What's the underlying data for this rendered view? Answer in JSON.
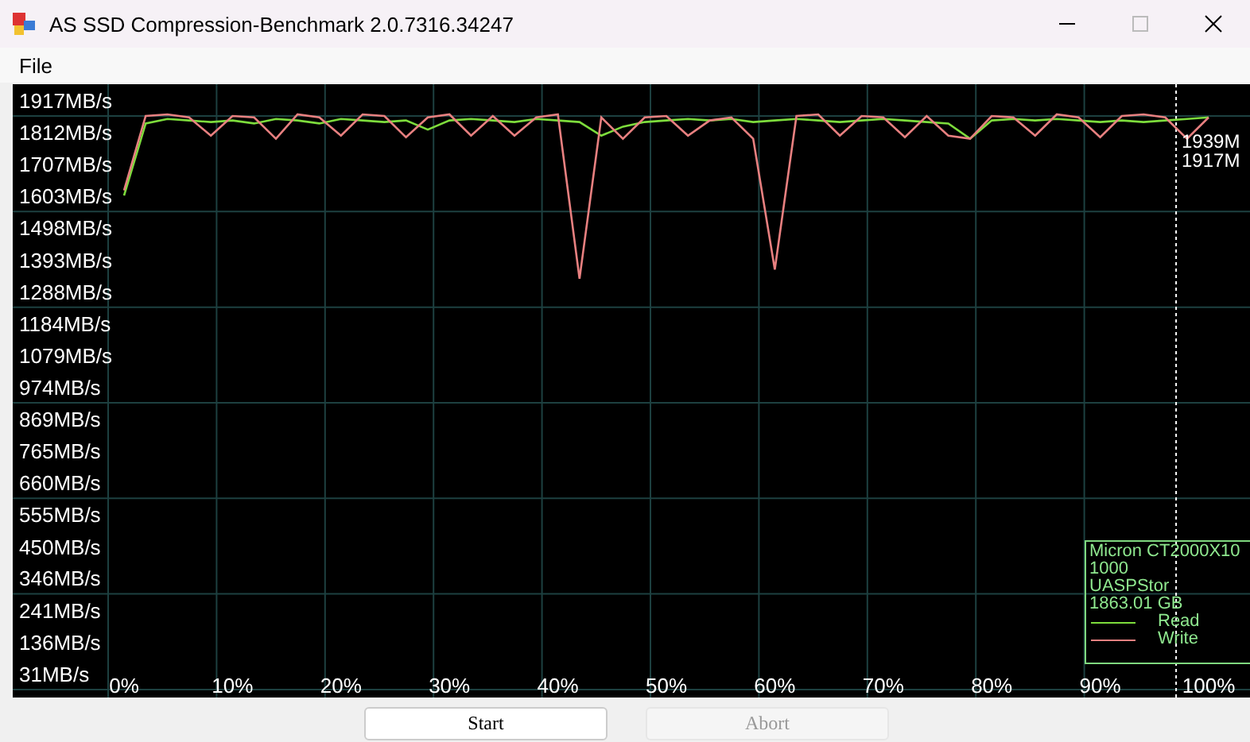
{
  "window": {
    "title": "AS SSD Compression-Benchmark 2.0.7316.34247"
  },
  "menu": [
    {
      "label": "File"
    }
  ],
  "chart": {
    "chart_data": {
      "type": "line",
      "xlim": [
        0,
        100
      ],
      "ylim": [
        31,
        1917
      ],
      "x": [
        0,
        2,
        4,
        6,
        8,
        10,
        12,
        14,
        16,
        18,
        20,
        22,
        24,
        26,
        28,
        30,
        32,
        34,
        36,
        38,
        40,
        42,
        44,
        46,
        48,
        50,
        52,
        54,
        56,
        58,
        60,
        62,
        64,
        66,
        68,
        70,
        72,
        74,
        76,
        78,
        80,
        82,
        84,
        86,
        88,
        90,
        92,
        94,
        96,
        98,
        100
      ],
      "series": [
        {
          "name": "Read",
          "color": "#7ddc3c",
          "values": [
            1603,
            1840,
            1855,
            1850,
            1845,
            1850,
            1840,
            1855,
            1850,
            1840,
            1855,
            1850,
            1845,
            1850,
            1820,
            1850,
            1855,
            1850,
            1845,
            1855,
            1850,
            1845,
            1800,
            1830,
            1845,
            1850,
            1855,
            1850,
            1855,
            1845,
            1850,
            1855,
            1850,
            1845,
            1850,
            1855,
            1850,
            1845,
            1840,
            1790,
            1850,
            1855,
            1850,
            1855,
            1850,
            1845,
            1850,
            1845,
            1850,
            1855,
            1860
          ]
        },
        {
          "name": "Write",
          "color": "#e88080",
          "values": [
            1620,
            1865,
            1870,
            1860,
            1800,
            1865,
            1860,
            1790,
            1870,
            1860,
            1800,
            1870,
            1865,
            1795,
            1860,
            1870,
            1800,
            1865,
            1800,
            1860,
            1870,
            1330,
            1860,
            1790,
            1860,
            1865,
            1800,
            1850,
            1860,
            1790,
            1360,
            1865,
            1870,
            1800,
            1865,
            1860,
            1795,
            1865,
            1800,
            1790,
            1865,
            1860,
            1800,
            1870,
            1860,
            1795,
            1865,
            1870,
            1860,
            1790,
            1860
          ]
        }
      ],
      "yticks": [
        {
          "value": 1917,
          "label": "1917MB/s"
        },
        {
          "value": 1812,
          "label": "1812MB/s"
        },
        {
          "value": 1707,
          "label": "1707MB/s"
        },
        {
          "value": 1603,
          "label": "1603MB/s"
        },
        {
          "value": 1498,
          "label": "1498MB/s"
        },
        {
          "value": 1393,
          "label": "1393MB/s"
        },
        {
          "value": 1288,
          "label": "1288MB/s"
        },
        {
          "value": 1184,
          "label": "1184MB/s"
        },
        {
          "value": 1079,
          "label": "1079MB/s"
        },
        {
          "value": 974,
          "label": "974MB/s"
        },
        {
          "value": 869,
          "label": "869MB/s"
        },
        {
          "value": 765,
          "label": "765MB/s"
        },
        {
          "value": 660,
          "label": "660MB/s"
        },
        {
          "value": 555,
          "label": "555MB/s"
        },
        {
          "value": 450,
          "label": "450MB/s"
        },
        {
          "value": 346,
          "label": "346MB/s"
        },
        {
          "value": 241,
          "label": "241MB/s"
        },
        {
          "value": 136,
          "label": "136MB/s"
        },
        {
          "value": 31,
          "label": "31MB/s"
        }
      ],
      "xticks": [
        {
          "value": 0,
          "label": "0%"
        },
        {
          "value": 10,
          "label": "10%"
        },
        {
          "value": 20,
          "label": "20%"
        },
        {
          "value": 30,
          "label": "30%"
        },
        {
          "value": 40,
          "label": "40%"
        },
        {
          "value": 50,
          "label": "50%"
        },
        {
          "value": 60,
          "label": "60%"
        },
        {
          "value": 70,
          "label": "70%"
        },
        {
          "value": 80,
          "label": "80%"
        },
        {
          "value": 90,
          "label": "90%"
        },
        {
          "value": 100,
          "label": "100%"
        }
      ],
      "ref_lines": [
        {
          "axis": "x",
          "value": 97
        }
      ],
      "annotations": [
        "1939M",
        "1917M"
      ]
    },
    "info": [
      "Micron CT2000X10",
      "1000",
      "UASPStor",
      "1863.01 GB"
    ]
  },
  "buttons": [
    {
      "label": "Start",
      "disabled": false
    },
    {
      "label": "Abort",
      "disabled": true
    }
  ]
}
